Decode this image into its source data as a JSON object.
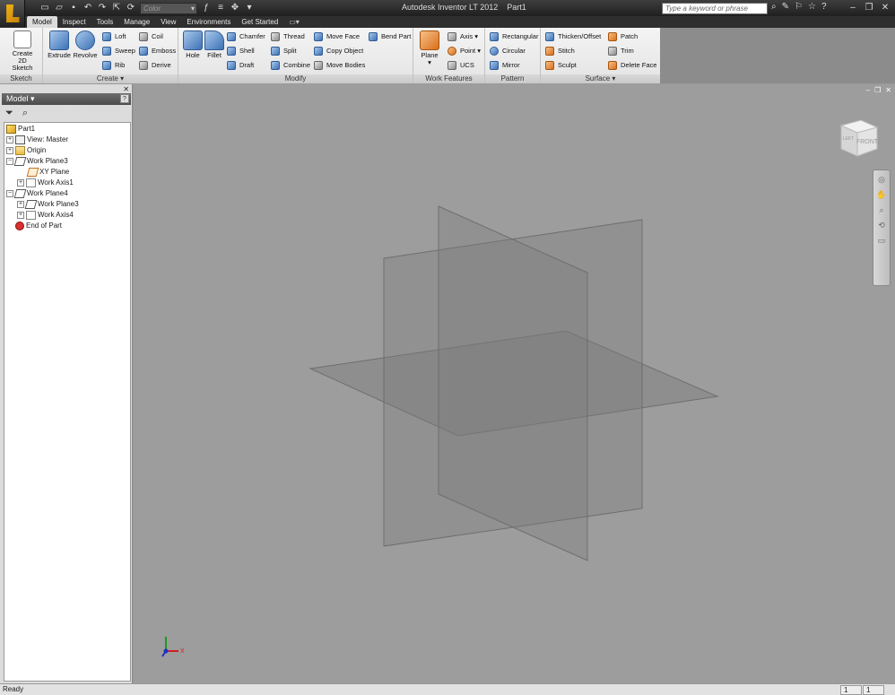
{
  "titlebar": {
    "app_name": "Autodesk Inventor LT 2012",
    "document": "Part1",
    "color_placeholder": "Color",
    "search_placeholder": "Type a keyword or phrase"
  },
  "tabs": [
    {
      "label": "Model",
      "active": true
    },
    {
      "label": "Inspect"
    },
    {
      "label": "Tools"
    },
    {
      "label": "Manage"
    },
    {
      "label": "View"
    },
    {
      "label": "Environments"
    },
    {
      "label": "Get Started"
    }
  ],
  "ribbon": {
    "sketch": {
      "label": "Sketch",
      "create_sketch_1": "Create",
      "create_sketch_2": "2D Sketch"
    },
    "create": {
      "label": "Create",
      "extrude": "Extrude",
      "revolve": "Revolve",
      "loft": "Loft",
      "sweep": "Sweep",
      "rib": "Rib",
      "coil": "Coil",
      "emboss": "Emboss",
      "derive": "Derive"
    },
    "modify": {
      "label": "Modify",
      "hole": "Hole",
      "fillet": "Fillet",
      "chamfer": "Chamfer",
      "shell": "Shell",
      "draft": "Draft",
      "thread": "Thread",
      "split": "Split",
      "combine": "Combine",
      "move_face": "Move Face",
      "copy_object": "Copy Object",
      "move_bodies": "Move Bodies",
      "bend_part": "Bend Part"
    },
    "work_features": {
      "label": "Work Features",
      "plane": "Plane",
      "axis": "Axis",
      "point": "Point",
      "ucs": "UCS"
    },
    "pattern": {
      "label": "Pattern",
      "rectangular": "Rectangular",
      "circular": "Circular",
      "mirror": "Mirror"
    },
    "surface": {
      "label": "Surface",
      "thicken_offset": "Thicken/Offset",
      "stitch": "Stitch",
      "sculpt": "Sculpt",
      "patch": "Patch",
      "trim": "Trim",
      "delete_face": "Delete Face"
    }
  },
  "browser": {
    "title": "Model",
    "help": "?",
    "tree": [
      {
        "label": "Part1"
      },
      {
        "label": "View: Master"
      },
      {
        "label": "Origin"
      },
      {
        "label": "Work Plane3"
      },
      {
        "label": "XY Plane"
      },
      {
        "label": "Work Axis1"
      },
      {
        "label": "Work Plane4"
      },
      {
        "label": "Work Plane3"
      },
      {
        "label": "Work Axis4"
      },
      {
        "label": "End of Part"
      }
    ]
  },
  "viewcube": {
    "front_label": "FRONT",
    "left_label": "LEFT"
  },
  "triad": {
    "x_label": "X"
  },
  "status": {
    "text": "Ready",
    "cell1": "1",
    "cell2": "1"
  }
}
